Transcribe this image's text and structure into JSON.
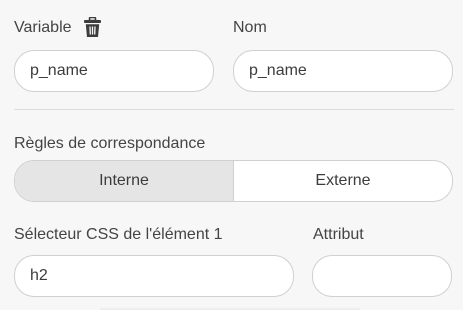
{
  "variable": {
    "label": "Variable",
    "delete_icon": "trash-icon",
    "value": "p_name"
  },
  "nom": {
    "label": "Nom",
    "value": "p_name"
  },
  "matching_rules": {
    "label": "Règles de correspondance",
    "options": [
      {
        "label": "Interne",
        "selected": true
      },
      {
        "label": "Externe",
        "selected": false
      }
    ]
  },
  "css_selector": {
    "label": "Sélecteur CSS de l'élément 1",
    "value": "h2"
  },
  "attribute": {
    "label": "Attribut",
    "value": ""
  },
  "colors": {
    "background": "#f7f7f7",
    "field_bg": "#ffffff",
    "border": "#d0d0d0",
    "active_segment": "#e5e5e5",
    "text": "#3c3c3c"
  }
}
